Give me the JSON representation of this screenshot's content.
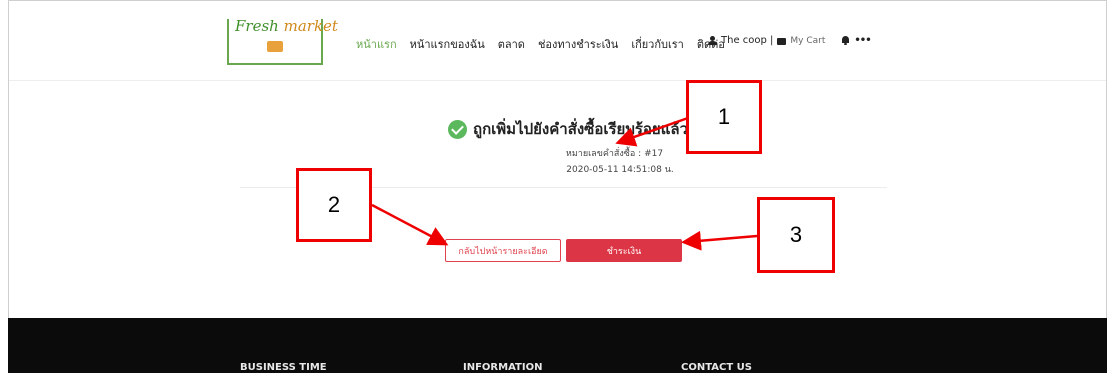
{
  "logo": {
    "word1": "Fresh",
    "word2": "market"
  },
  "nav": {
    "links": [
      "หน้าแรก",
      "หน้าแรกของฉัน",
      "ตลาด",
      "ช่องทางชำระเงิน",
      "เกี่ยวกับเรา",
      "ติดต่อ"
    ],
    "active_index": 0,
    "user_label": "The coop |",
    "cart_label": "My Cart",
    "more_label": "•••"
  },
  "confirmation": {
    "message": "ถูกเพิ่มไปยังคำสั่งซื้อเรียบร้อยแล้ว",
    "order_number": "หมายเลขคำสั่งซื้อ : #17",
    "order_time": "2020-05-11 14:51:08 น."
  },
  "buttons": {
    "back_label": "กลับไปหน้ารายละเอียด",
    "pay_label": "ชำระเงิน"
  },
  "callouts": {
    "one": "1",
    "two": "2",
    "three": "3"
  },
  "footer": {
    "headings": [
      "BUSINESS TIME",
      "INFORMATION",
      "CONTACT US"
    ]
  },
  "colors": {
    "accent_green": "#6aa84f",
    "danger_red": "#dc3545",
    "callout_red": "#e00000",
    "footer_bg": "#0b0b0b"
  }
}
